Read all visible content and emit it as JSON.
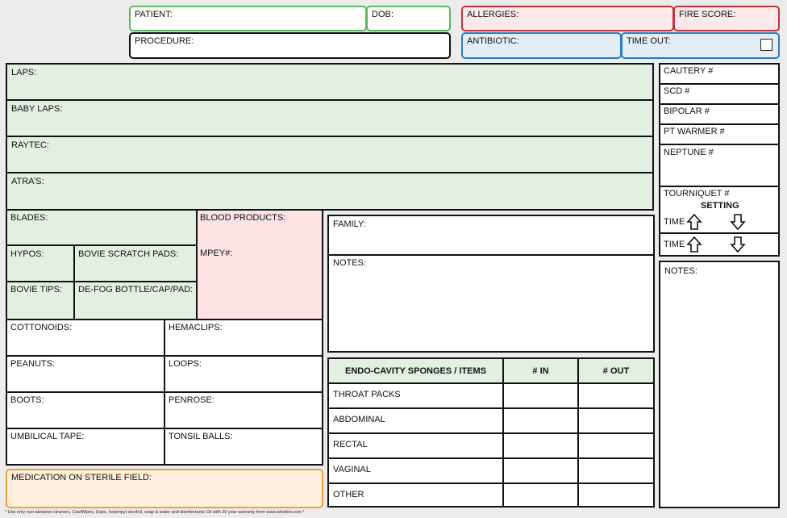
{
  "header": {
    "patient": "PATIENT:",
    "dob": "DOB:",
    "procedure": "PROCEDURE:",
    "allergies": "ALLERGIES:",
    "fire_score": "FIRE SCORE:",
    "antibiotic": "ANTIBIOTIC:",
    "time_out": "TIME OUT:"
  },
  "counts": {
    "laps": "LAPS:",
    "baby_laps": "BABY LAPS:",
    "raytec": "RAYTEC:",
    "atras": "ATRA’S:"
  },
  "supplies": {
    "blades": "BLADES:",
    "blood_products": "BLOOD PRODUCTS:",
    "mpey": "MPEY#:",
    "hypos": "HYPOS:",
    "bovie_scratch_pads": "BOVIE SCRATCH PADS:",
    "bovie_tips": "BOVIE TIPS:",
    "defog": "DE-FOG BOTTLE/CAP/PAD:"
  },
  "small_items": {
    "cottonoids": "COTTONOIDS:",
    "hemaclips": "HEMACLIPS:",
    "peanuts": "PEANUTS:",
    "loops": "LOOPS:",
    "boots": "BOOTS:",
    "penrose": "PENROSE:",
    "umbilical_tape": "UMBILICAL TAPE:",
    "tonsil_balls": "TONSIL BALLS:"
  },
  "medication": "MEDICATION ON STERILE FIELD:",
  "family": "FAMILY:",
  "notes_center": "NOTES:",
  "endo_table": {
    "headers": [
      "ENDO-CAVITY SPONGES / ITEMS",
      "# IN",
      "# OUT"
    ],
    "rows": [
      "THROAT PACKS",
      "ABDOMINAL",
      "RECTAL",
      "VAGINAL",
      "OTHER"
    ]
  },
  "equipment": {
    "cautery": "CAUTERY #",
    "scd": "SCD #",
    "bipolar": "BIPOLAR #",
    "pt_warmer": "PT WARMER #",
    "neptune": "NEPTUNE #",
    "tourniquet": "TOURNIQUET #",
    "setting": "SETTING",
    "time1": "TIME",
    "time2": "TIME"
  },
  "notes_right": "NOTES:",
  "footer": "* Use only non-abrasive cleaners. CaviWipes, Expo, Isopropyl alcohol, soap & water and disinfectants Ok with 20 year warranty from www.ahutton.com *"
}
